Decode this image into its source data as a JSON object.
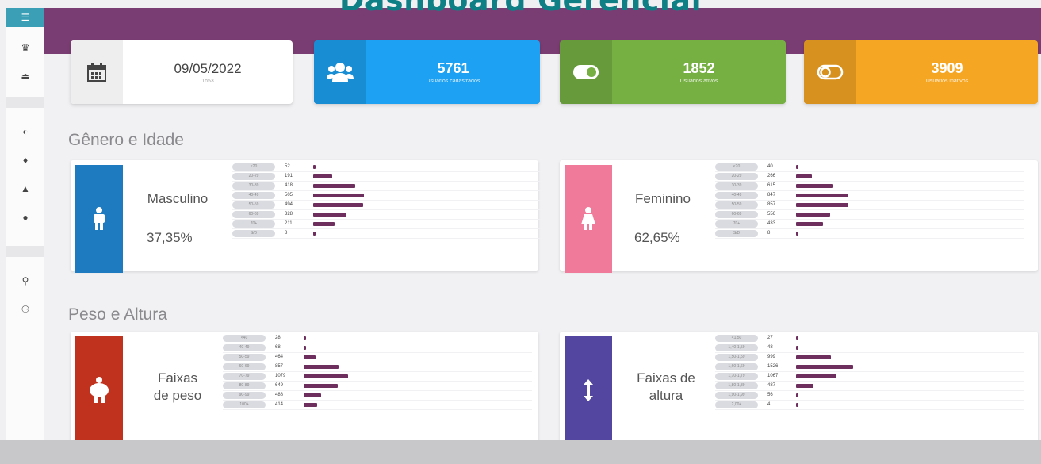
{
  "overlay_title": "Dashboard Gerencial",
  "sidebar": {
    "items": [
      {
        "icon": "menu-icon",
        "glyph": "☰"
      },
      {
        "icon": "users-icon",
        "glyph": "♛"
      },
      {
        "icon": "upload-icon",
        "glyph": "⏏"
      },
      {
        "icon": "toggle-icon",
        "glyph": "◐"
      },
      {
        "icon": "pin-icon",
        "glyph": "♦"
      },
      {
        "icon": "group-icon",
        "glyph": "▲"
      },
      {
        "icon": "circle-icon",
        "glyph": "●"
      },
      {
        "icon": "key-icon",
        "glyph": "⚲"
      },
      {
        "icon": "person-icon",
        "glyph": "⚆"
      }
    ]
  },
  "stats": {
    "date": {
      "value": "09/05/2022",
      "sub": "1h53"
    },
    "total": {
      "value": "5761",
      "sub": "Usuários cadastrados",
      "color": "#1da1f2"
    },
    "active": {
      "value": "1852",
      "sub": "Usuários ativos",
      "color": "#76b043"
    },
    "inactive": {
      "value": "3909",
      "sub": "Usuários inativos",
      "color": "#f5a623"
    }
  },
  "sections": {
    "gender_age": "Gênero e Idade",
    "weight_height": "Peso e Altura"
  },
  "male": {
    "label": "Masculino",
    "percent": "37,35%",
    "color": "#1f7bc0",
    "rows": [
      {
        "range": "<20",
        "value": "52",
        "bar": 0.04
      },
      {
        "range": "20-29",
        "value": "191",
        "bar": 0.38
      },
      {
        "range": "30-39",
        "value": "418",
        "bar": 0.83
      },
      {
        "range": "40-49",
        "value": "505",
        "bar": 1.0
      },
      {
        "range": "50-59",
        "value": "494",
        "bar": 0.98
      },
      {
        "range": "60-69",
        "value": "328",
        "bar": 0.65
      },
      {
        "range": "70+",
        "value": "211",
        "bar": 0.42
      },
      {
        "range": "S/D",
        "value": "8",
        "bar": 0.02
      }
    ]
  },
  "female": {
    "label": "Feminino",
    "percent": "62,65%",
    "color": "#f07a9a",
    "rows": [
      {
        "range": "<20",
        "value": "40",
        "bar": 0.04
      },
      {
        "range": "20-29",
        "value": "266",
        "bar": 0.31
      },
      {
        "range": "30-39",
        "value": "615",
        "bar": 0.71
      },
      {
        "range": "40-49",
        "value": "847",
        "bar": 0.98
      },
      {
        "range": "50-59",
        "value": "857",
        "bar": 1.0
      },
      {
        "range": "60-69",
        "value": "556",
        "bar": 0.65
      },
      {
        "range": "70+",
        "value": "433",
        "bar": 0.51
      },
      {
        "range": "S/D",
        "value": "8",
        "bar": 0.02
      }
    ]
  },
  "weight": {
    "label_line1": "Faixas",
    "label_line2": "de peso",
    "color": "#c0321e",
    "rows": [
      {
        "range": "<40",
        "value": "28",
        "bar": 0.02
      },
      {
        "range": "40-49",
        "value": "68",
        "bar": 0.03
      },
      {
        "range": "50-59",
        "value": "464",
        "bar": 0.27
      },
      {
        "range": "60-69",
        "value": "857",
        "bar": 0.78
      },
      {
        "range": "70-79",
        "value": "1079",
        "bar": 1.0
      },
      {
        "range": "80-89",
        "value": "649",
        "bar": 0.77
      },
      {
        "range": "90-99",
        "value": "488",
        "bar": 0.4
      },
      {
        "range": "100+",
        "value": "414",
        "bar": 0.3
      }
    ]
  },
  "height": {
    "label_line1": "Faixas de",
    "label_line2": "altura",
    "color": "#5346a0",
    "rows": [
      {
        "range": "<1,50",
        "value": "27",
        "bar": 0.02
      },
      {
        "range": "1,40-1,59",
        "value": "48",
        "bar": 0.03
      },
      {
        "range": "1,50-1,59",
        "value": "999",
        "bar": 0.61
      },
      {
        "range": "1,60-1,69",
        "value": "1526",
        "bar": 1.0
      },
      {
        "range": "1,70-1,79",
        "value": "1067",
        "bar": 0.71
      },
      {
        "range": "1,80-1,89",
        "value": "487",
        "bar": 0.31
      },
      {
        "range": "1,90-1,99",
        "value": "56",
        "bar": 0.04
      },
      {
        "range": "2,00+",
        "value": "4",
        "bar": 0.01
      }
    ]
  }
}
